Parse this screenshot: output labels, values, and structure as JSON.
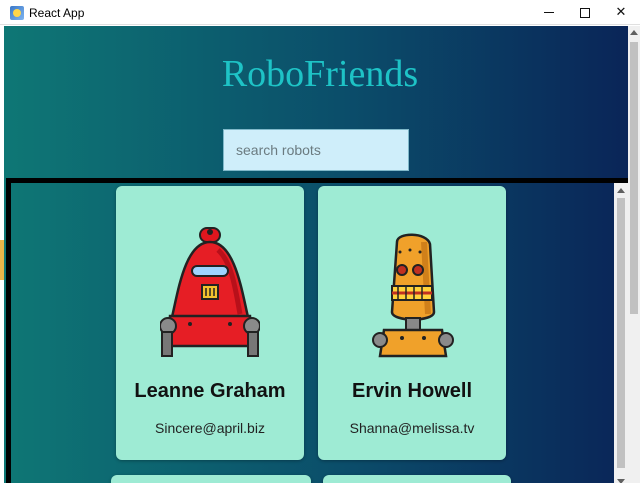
{
  "window": {
    "title": "React App",
    "controls": {
      "minimize": "minimize",
      "maximize": "maximize",
      "close": "✕"
    }
  },
  "page": {
    "title": "RoboFriends",
    "search": {
      "placeholder": "search robots",
      "value": ""
    }
  },
  "robots": [
    {
      "name": "Leanne Graham",
      "email": "Sincere@april.biz",
      "avatar": "red-robot-icon"
    },
    {
      "name": "Ervin Howell",
      "email": "Shanna@melissa.tv",
      "avatar": "orange-robot-icon"
    }
  ],
  "colors": {
    "background_start": "#0e7775",
    "background_end": "#0a2558",
    "title": "#1ec3c6",
    "card": "#9eebd4",
    "search_bg": "#cfeefa"
  }
}
